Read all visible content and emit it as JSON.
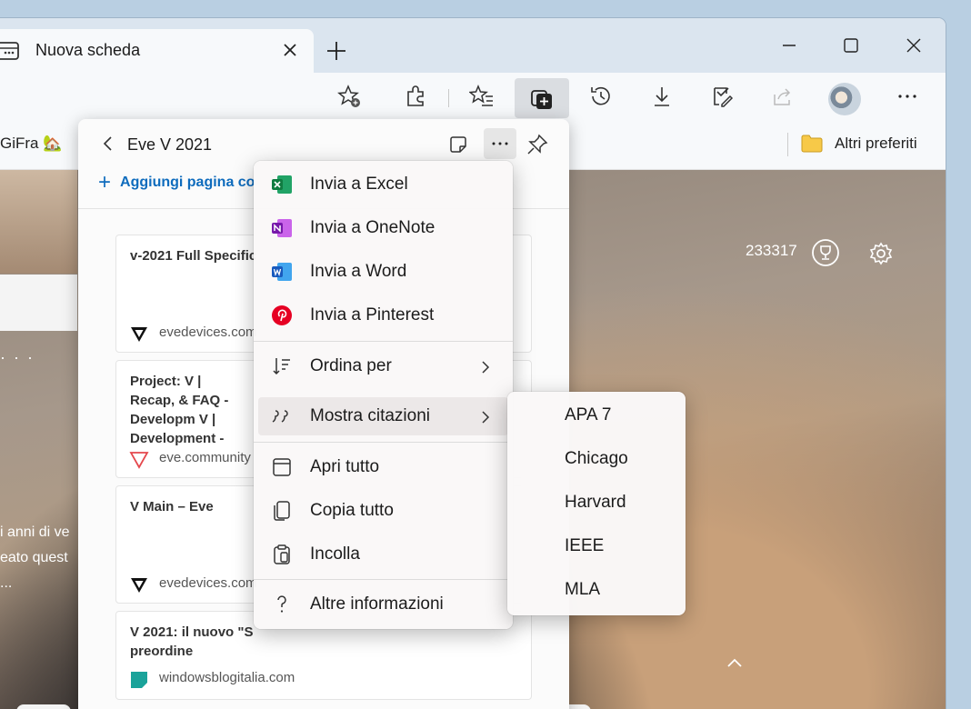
{
  "tab": {
    "title": "Nuova scheda"
  },
  "favorites": {
    "left_item": "GiFra 🏡",
    "other": "Altri preferiti"
  },
  "ntp": {
    "score": "233317",
    "dots": "· · ·",
    "text_lines": [
      "i anni di ve",
      "eato quest",
      "..."
    ]
  },
  "collection": {
    "title": "Eve V 2021",
    "add_page": "Aggiungi pagina co",
    "cards": [
      {
        "title": "v-2021 Full Specific",
        "site": "evedevices.com"
      },
      {
        "title": "Project: V | Recap, & FAQ - Developm V | Development -",
        "site": "eve.community"
      },
      {
        "title": "V Main – Eve",
        "site": "evedevices.com"
      },
      {
        "title": "V 2021: il nuovo \"S preordine",
        "site": "windowsblogitalia.com"
      }
    ]
  },
  "menu": {
    "items": [
      {
        "label": "Invia a Excel",
        "icon": "excel-icon"
      },
      {
        "label": "Invia a OneNote",
        "icon": "onenote-icon"
      },
      {
        "label": "Invia a Word",
        "icon": "word-icon"
      },
      {
        "label": "Invia a Pinterest",
        "icon": "pinterest-icon"
      },
      {
        "label": "Ordina per",
        "icon": "sort-icon"
      },
      {
        "label": "Mostra citazioni",
        "icon": "quote-icon"
      },
      {
        "label": "Apri tutto",
        "icon": "open-all-icon"
      },
      {
        "label": "Copia tutto",
        "icon": "copy-icon"
      },
      {
        "label": "Incolla",
        "icon": "paste-icon"
      },
      {
        "label": "Altre informazioni",
        "icon": "help-icon"
      }
    ]
  },
  "submenu": {
    "items": [
      "APA 7",
      "Chicago",
      "Harvard",
      "IEEE",
      "MLA"
    ]
  },
  "colors": {
    "accent": "#0f6cbd",
    "excel": "#107c41",
    "onenote": "#7719aa",
    "word": "#185abd",
    "pinterest": "#e60023"
  }
}
